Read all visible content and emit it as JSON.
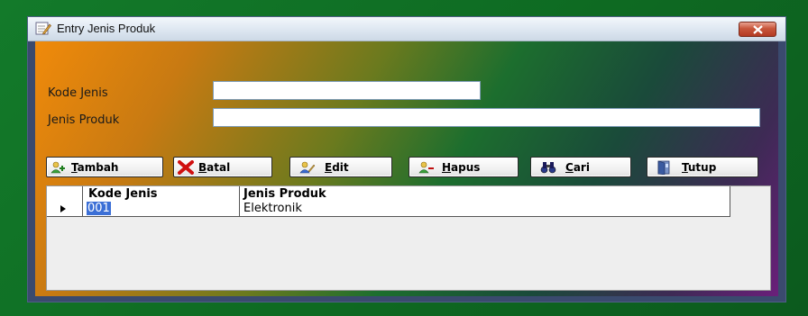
{
  "window": {
    "title": "Entry Jenis Produk"
  },
  "form": {
    "kode_label": "Kode Jenis",
    "kode_value": "",
    "jenis_label": "Jenis Produk",
    "jenis_value": ""
  },
  "buttons": [
    {
      "pre": "",
      "acc": "T",
      "post": "ambah",
      "icon": "add-user-icon"
    },
    {
      "pre": "",
      "acc": "B",
      "post": "atal",
      "icon": "cancel-x-icon"
    },
    {
      "pre": "",
      "acc": "E",
      "post": "dit",
      "icon": "edit-user-icon"
    },
    {
      "pre": "",
      "acc": "H",
      "post": "apus",
      "icon": "delete-user-icon"
    },
    {
      "pre": "",
      "acc": "C",
      "post": "ari",
      "icon": "binoculars-icon"
    },
    {
      "pre": "",
      "acc": "T",
      "post": "utup",
      "icon": "exit-door-icon"
    }
  ],
  "grid": {
    "columns": [
      "Kode Jenis",
      "Jenis Produk"
    ],
    "rows": [
      {
        "kode": "001",
        "jenis": "Elektronik"
      }
    ]
  }
}
